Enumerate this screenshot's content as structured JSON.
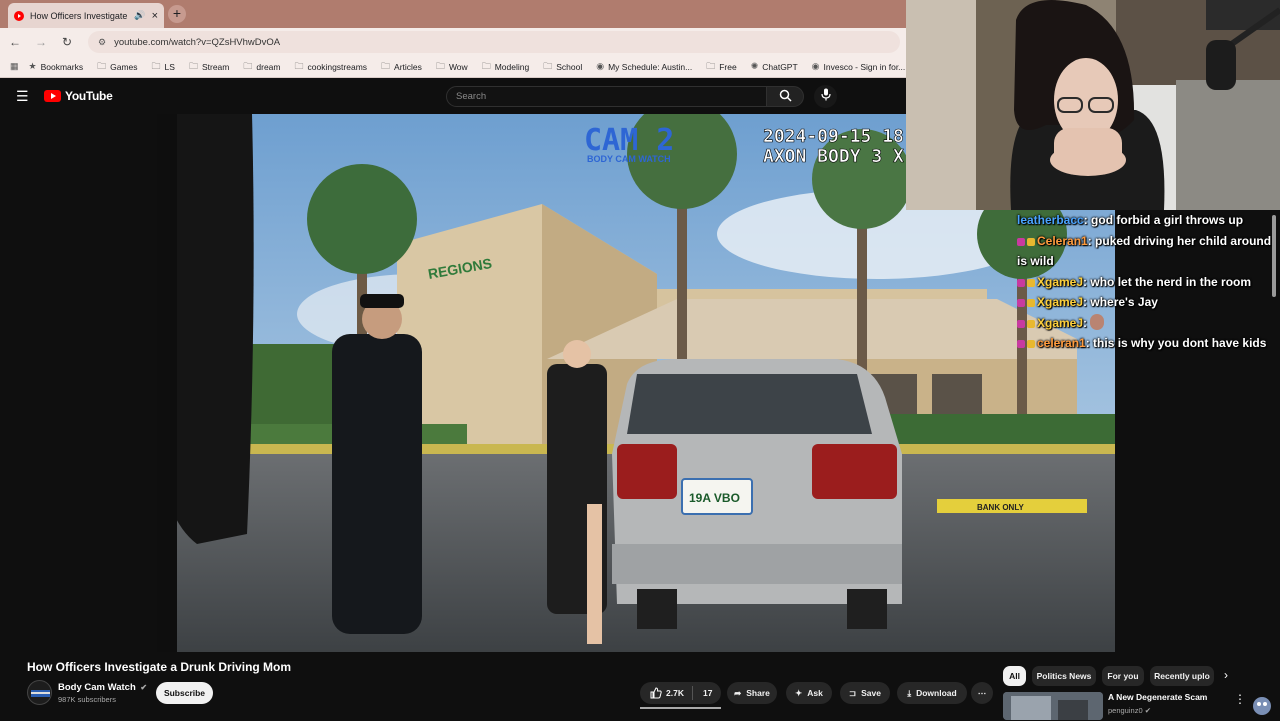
{
  "browser": {
    "tab_title": "How Officers Investigate a D",
    "url": "youtube.com/watch?v=QZsHVhwDvOA",
    "bookmarks": [
      {
        "label": "Bookmarks",
        "icon": "star-icon"
      },
      {
        "label": "Games",
        "icon": "folder-icon"
      },
      {
        "label": "LS",
        "icon": "folder-icon"
      },
      {
        "label": "Stream",
        "icon": "folder-icon"
      },
      {
        "label": "dream",
        "icon": "folder-icon"
      },
      {
        "label": "cookingstreams",
        "icon": "folder-icon"
      },
      {
        "label": "Articles",
        "icon": "folder-icon"
      },
      {
        "label": "Wow",
        "icon": "folder-icon"
      },
      {
        "label": "Modeling",
        "icon": "folder-icon"
      },
      {
        "label": "School",
        "icon": "folder-icon"
      },
      {
        "label": "My Schedule: Austin...",
        "icon": "site-icon"
      },
      {
        "label": "Free",
        "icon": "folder-icon"
      },
      {
        "label": "ChatGPT",
        "icon": "chatgpt-icon"
      },
      {
        "label": "Invesco - Sign in for...",
        "icon": "site-icon"
      }
    ]
  },
  "youtube": {
    "logo_text": "YouTube",
    "search_placeholder": "Search",
    "video": {
      "overlay_cam": "CAM 2",
      "overlay_cam_sub": "BODY CAM WATCH",
      "overlay_timestamp": "2024-09-15 18",
      "overlay_device": "AXON BODY 3 X",
      "sign_text": "REGIONS",
      "plate": "19A VBO",
      "curb_text": "BANK ONLY"
    },
    "title": "How Officers Investigate a Drunk Driving Mom",
    "channel": {
      "name": "Body Cam Watch",
      "subscribers": "987K subscribers",
      "subscribe_label": "Subscribe"
    },
    "actions": {
      "likes": "2.7K",
      "dislikes": "17",
      "share": "Share",
      "ask": "Ask",
      "save": "Save",
      "download": "Download"
    },
    "chips": [
      "All",
      "Politics News",
      "For you",
      "Recently uplo"
    ],
    "recommended": {
      "title": "A New Degenerate Scam",
      "channel": "penguinz0"
    }
  },
  "chat": {
    "messages": [
      {
        "user": "leatherbacc",
        "text": "god forbid a girl throws up",
        "color": "#4aa3ff"
      },
      {
        "user": "Celeran1",
        "text": "puked driving her child around is wild",
        "color": "#ff9b3d"
      },
      {
        "user": "XgameJ",
        "text": "who let the nerd in the room",
        "color": "#ffd13b"
      },
      {
        "user": "XgameJ",
        "text": "where's Jay",
        "color": "#ffd13b"
      },
      {
        "user": "XgameJ",
        "text": "",
        "color": "#ffd13b"
      },
      {
        "user": "celeran1",
        "text": "this is why you dont have kids",
        "color": "#ff9b3d"
      }
    ]
  }
}
